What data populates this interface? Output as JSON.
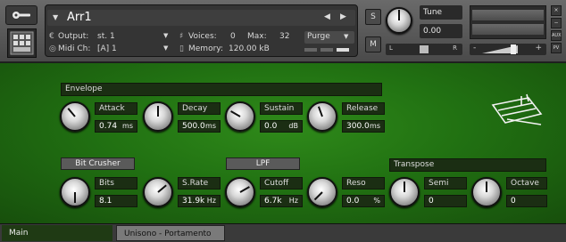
{
  "header": {
    "instrument_name": "Arr1",
    "output_label": "Output:",
    "output_value": "st. 1",
    "voices_label": "Voices:",
    "voices_value": "0",
    "max_label": "Max:",
    "max_value": "32",
    "purge_label": "Purge",
    "midi_label": "Midi Ch:",
    "midi_value": "[A] 1",
    "memory_label": "Memory:",
    "memory_value": "120.00 kB",
    "solo_label": "S",
    "mute_label": "M",
    "tune_label": "Tune",
    "tune_value": "0.00",
    "pan_left": "L",
    "pan_right": "R",
    "vol_minus": "-",
    "vol_plus": "+",
    "side_close": "×",
    "side_min": "−",
    "aux_label": "AUX",
    "pv_label": "PV"
  },
  "sections": {
    "envelope": "Envelope",
    "bit_crusher": "Bit Crusher",
    "lpf": "LPF",
    "transpose": "Transpose"
  },
  "knobs": {
    "attack": {
      "label": "Attack",
      "value": "0.74",
      "unit": "ms"
    },
    "decay": {
      "label": "Decay",
      "value": "500.0",
      "unit": "ms"
    },
    "sustain": {
      "label": "Sustain",
      "value": "0.0",
      "unit": "dB"
    },
    "release": {
      "label": "Release",
      "value": "300.0",
      "unit": "ms"
    },
    "bits": {
      "label": "Bits",
      "value": "8.1",
      "unit": ""
    },
    "srate": {
      "label": "S.Rate",
      "value": "31.9k",
      "unit": "Hz"
    },
    "cutoff": {
      "label": "Cutoff",
      "value": "6.7k",
      "unit": "Hz"
    },
    "reso": {
      "label": "Reso",
      "value": "0.0",
      "unit": "%"
    },
    "semi": {
      "label": "Semi",
      "value": "0",
      "unit": ""
    },
    "octave": {
      "label": "Octave",
      "value": "0",
      "unit": ""
    }
  },
  "tabs": [
    "Main",
    "Unisono - Portamento"
  ],
  "icons": {
    "wrench": "wrench-icon",
    "pad": "instrument-pad-icon",
    "logo": "keyboard-logo-icon"
  },
  "colors": {
    "panel_green": "#217112",
    "label_dark": "#1b2e13",
    "header_grey": "#5a5a5a"
  }
}
